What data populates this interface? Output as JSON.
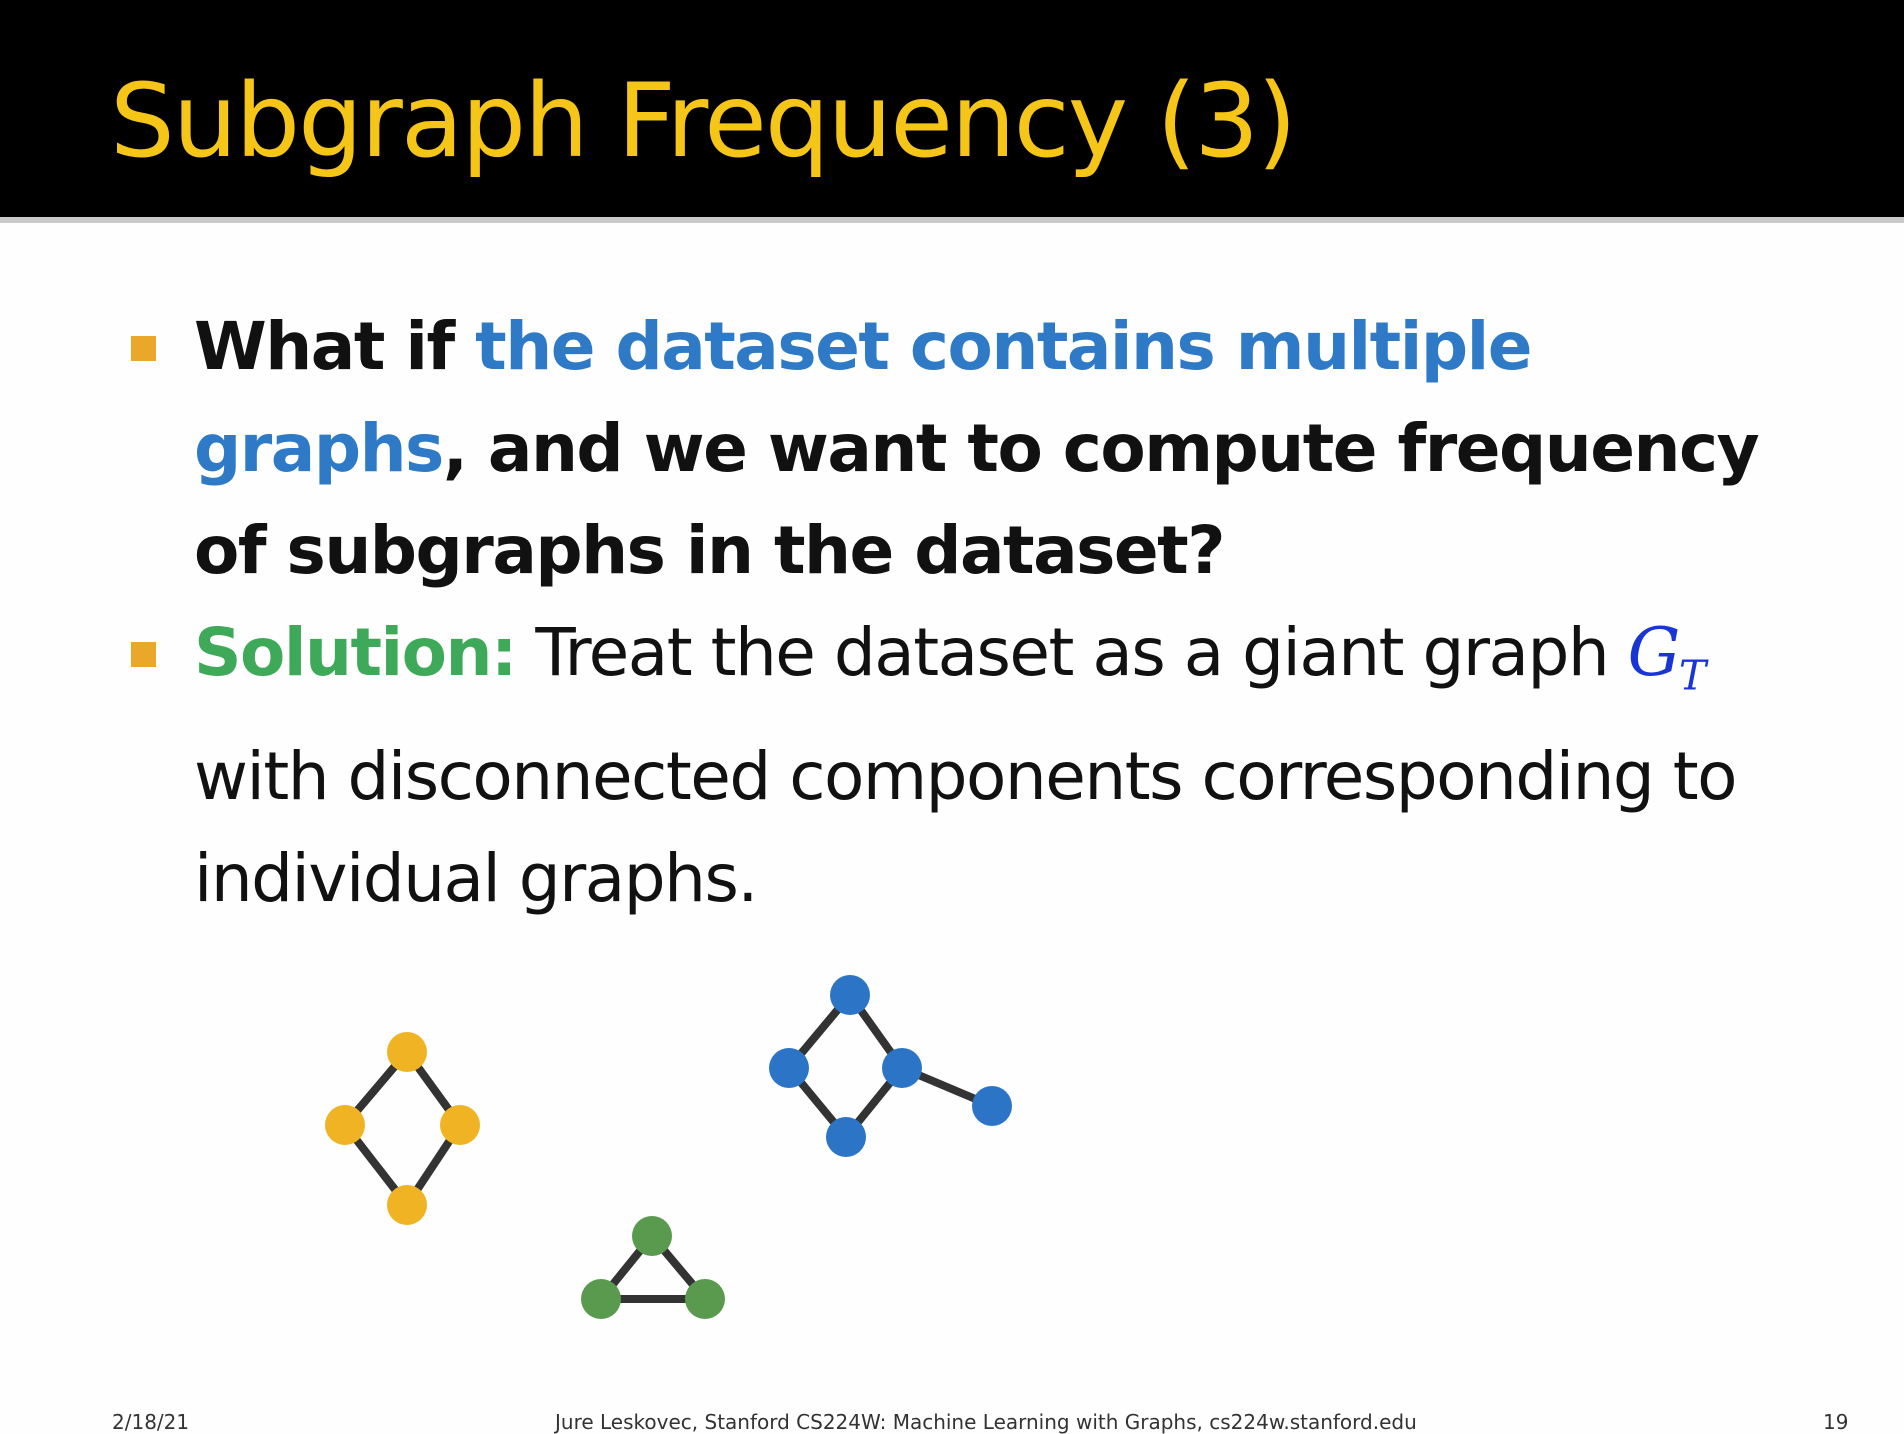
{
  "slide": {
    "title": "Subgraph Frequency (3)",
    "bullets": [
      {
        "segments": [
          {
            "text": "What if ",
            "style": "plain"
          },
          {
            "text": "the dataset contains multiple graphs",
            "style": "blue"
          },
          {
            "text": ", and we want to compute frequency of subgraphs in the dataset?",
            "style": "plain"
          }
        ]
      },
      {
        "segments": [
          {
            "text": "Solution:",
            "style": "green"
          },
          {
            "text": " Treat the dataset as a giant graph ",
            "style": "plain"
          },
          {
            "text": "G",
            "style": "math"
          },
          {
            "text": "T",
            "style": "math-sub"
          },
          {
            "text": " with disconnected components corresponding to individual graphs.",
            "style": "plain"
          }
        ]
      }
    ],
    "footer": {
      "date": "2/18/21",
      "credit": "Jure Leskovec, Stanford CS224W: Machine Learning with Graphs, cs224w.stanford.edu",
      "page": "19"
    },
    "colors": {
      "title": "#f5c518",
      "accent_blue": "#2f7ac7",
      "accent_green": "#3fa95a",
      "bullet": "#e9a82a",
      "node_yellow": "#f0b323",
      "node_blue": "#2c75c6",
      "node_green": "#5a9a4f",
      "edge": "#333333"
    }
  }
}
